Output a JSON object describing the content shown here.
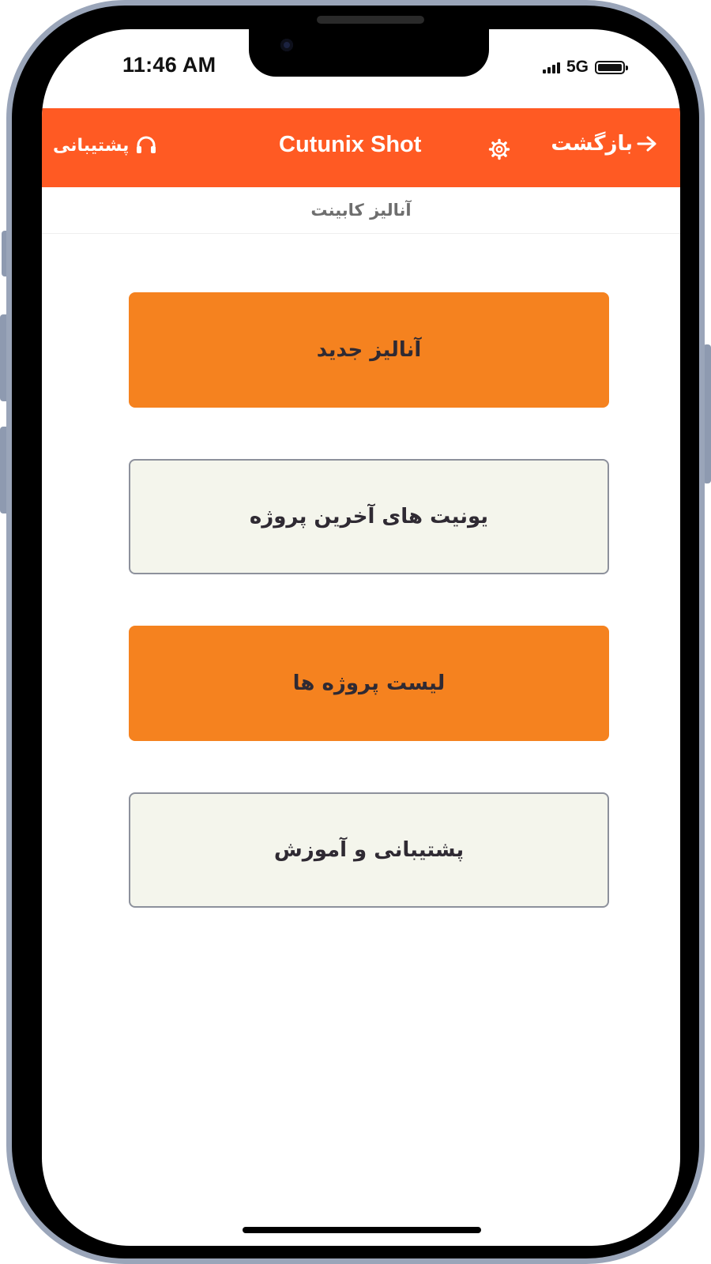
{
  "status_bar": {
    "time": "11:46 AM",
    "network": "5G",
    "battery_level": 1.0
  },
  "header": {
    "title": "Cutunix Shot",
    "back_label": "بازگشت",
    "support_label": "پشتیبانی",
    "icons": [
      "arrow-right-icon",
      "gear-icon",
      "headset-icon"
    ],
    "color": "#ff5a23"
  },
  "subtitle": "آنالیز کابینت",
  "menu": {
    "buttons": [
      {
        "label": "آنالیز جدید",
        "style": "primary"
      },
      {
        "label": "یونیت های آخرین پروژه",
        "style": "secondary"
      },
      {
        "label": "لیست پروژه ها",
        "style": "primary"
      },
      {
        "label": "پشتیبانی و آموزش",
        "style": "secondary"
      }
    ]
  },
  "colors": {
    "accent_orange": "#f5821f",
    "header_orange": "#ff5a23",
    "secondary_button_bg": "#f4f5ec",
    "secondary_button_border": "#8d919c",
    "button_text": "#2f2a33",
    "subtitle_text": "#6e6e6e"
  }
}
